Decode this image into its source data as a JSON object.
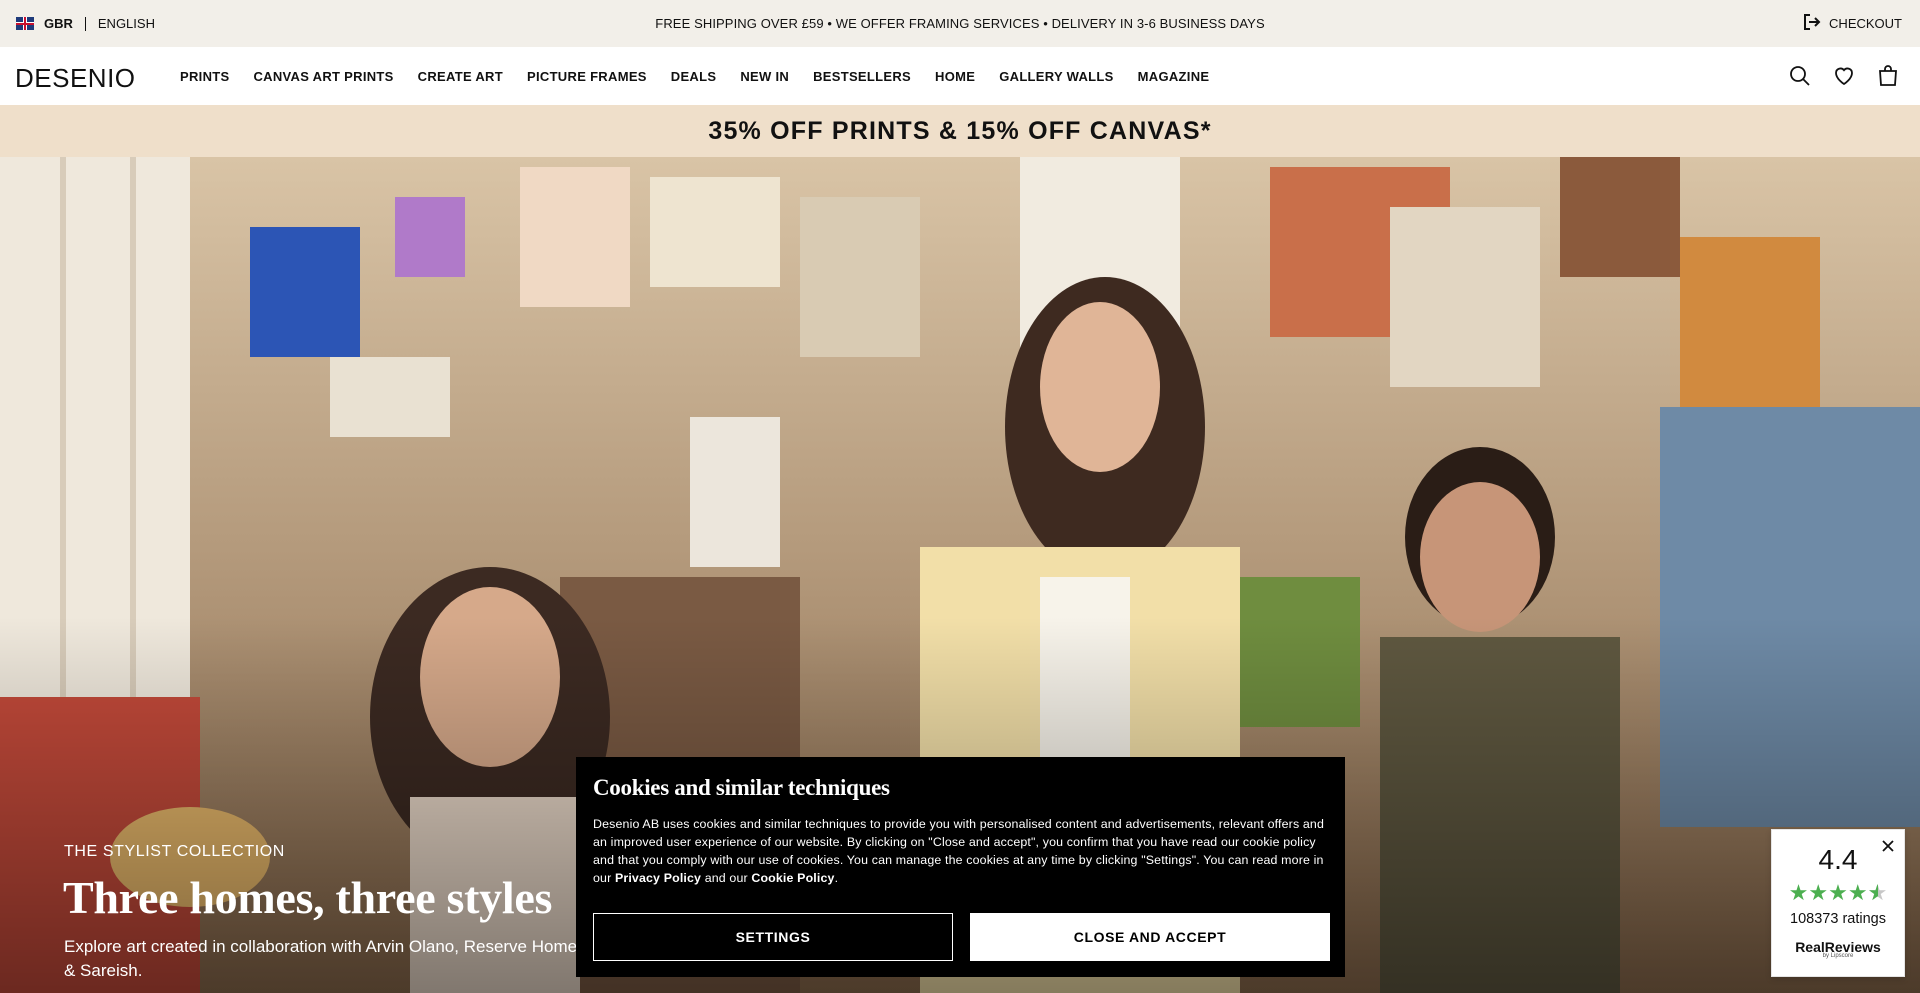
{
  "topbar": {
    "country": "GBR",
    "language": "ENGLISH",
    "announcement": "FREE SHIPPING OVER £59 • WE OFFER FRAMING SERVICES • DELIVERY IN 3-6 BUSINESS DAYS",
    "checkout_label": "CHECKOUT"
  },
  "header": {
    "logo": "DESENIO",
    "nav": [
      {
        "label": "PRINTS"
      },
      {
        "label": "CANVAS ART PRINTS"
      },
      {
        "label": "CREATE ART"
      },
      {
        "label": "PICTURE FRAMES"
      },
      {
        "label": "DEALS"
      },
      {
        "label": "NEW IN"
      },
      {
        "label": "BESTSELLERS"
      },
      {
        "label": "HOME"
      },
      {
        "label": "GALLERY WALLS"
      },
      {
        "label": "MAGAZINE"
      }
    ],
    "icons": [
      "search-icon",
      "heart-icon",
      "bag-icon"
    ]
  },
  "promo_banner": "35% OFF PRINTS & 15% OFF CANVAS*",
  "hero": {
    "kicker": "THE STYLIST COLLECTION",
    "title": "Three homes, three styles",
    "subtitle": "Explore art created in collaboration with Arvin Olano, Reserve Home & Sareish."
  },
  "cookie": {
    "title": "Cookies and similar techniques",
    "body_text": "Desenio AB uses cookies and similar techniques to provide you with personalised content and advertisements, relevant offers and an improved user experience of our website. By clicking on \"Close and accept\", you confirm that you have read our cookie policy and that you comply with our use of cookies. You can manage the cookies at any time by clicking \"Settings\". You can read more in our",
    "privacy_link": "Privacy Policy",
    "and_our": "and our",
    "cookie_link": "Cookie Policy",
    "end": ".",
    "settings_label": "SETTINGS",
    "accept_label": "CLOSE AND ACCEPT"
  },
  "rating": {
    "score": "4.4",
    "stars": 4.4,
    "count_text": "108373 ratings",
    "brand": "RealReviews",
    "brand_sub": "by Lipscore"
  },
  "colors": {
    "topbar_bg": "#f2efe9",
    "promo_bg": "#efdfca",
    "star_green": "#4caf50"
  }
}
